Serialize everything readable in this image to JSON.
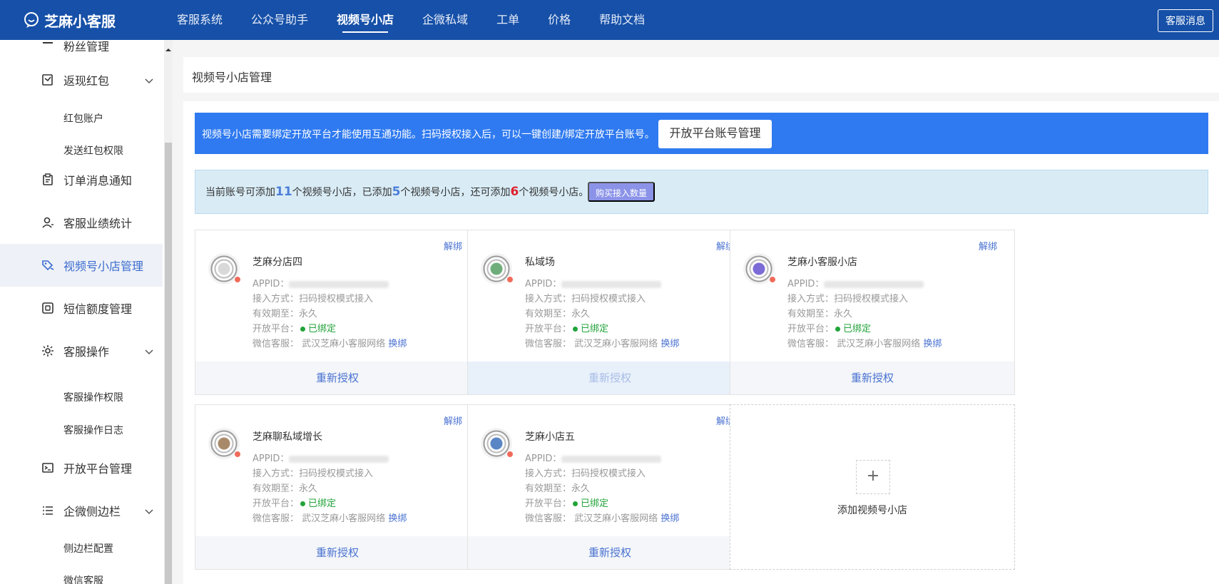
{
  "app": {
    "name": "芝麻小客服"
  },
  "nav": {
    "items": [
      "客服系统",
      "公众号助手",
      "视频号小店",
      "企微私域",
      "工单",
      "价格",
      "帮助文档"
    ],
    "active_index": 2,
    "message_button": "客服消息"
  },
  "sidebar": {
    "partial_top": "粉丝管理",
    "items": {
      "cashback": "返现红包",
      "redpack_account": "红包账户",
      "redpack_permission": "发送红包权限",
      "order_notify": "订单消息通知",
      "performance": "客服业绩统计",
      "video_shop": "视频号小店管理",
      "sms_quota": "短信额度管理",
      "cs_ops": "客服操作",
      "cs_ops_permission": "客服操作权限",
      "cs_ops_log": "客服操作日志",
      "open_platform": "开放平台管理",
      "wecom_sidebar": "企微侧边栏",
      "sidebar_config": "侧边栏配置",
      "wechat_cs": "微信客服"
    },
    "icons": {
      "cashback": "redpack-icon",
      "order_notify": "clipboard-icon",
      "performance": "user-stats-icon",
      "video_shop": "shop-icon",
      "sms_quota": "sms-icon",
      "cs_ops": "settings-icon",
      "open_platform": "terminal-icon",
      "wecom_sidebar": "list-icon"
    }
  },
  "page": {
    "title": "视频号小店管理",
    "notice_blue": "视频号小店需要绑定开放平台才能使用互通功能。扫码授权接入后，可以一键创建/绑定开放平台账号。",
    "open_platform_button": "开放平台账号管理",
    "quota": {
      "prefix": "当前账号可添加",
      "total": "11",
      "mid1": "个视频号小店，已添加",
      "added": "5",
      "mid2": "个视频号小店，还可添加",
      "remaining": "6",
      "suffix": "个视频号小店。",
      "buy_button": "购买接入数量"
    },
    "labels": {
      "appid": "APPID：",
      "access_mode": "接入方式：",
      "valid_until": "有效期至：",
      "open_platform": "开放平台：",
      "wechat_cs": "微信客服：",
      "unbind": "解绑",
      "reauthorize": "重新授权",
      "change_binding": "换绑",
      "add_shop": "添加视频号小店",
      "add_plus": "+"
    },
    "shops": [
      {
        "name": "芝麻分店四",
        "access_mode": "扫码授权模式接入",
        "valid_until": "永久",
        "platform_status": "已绑定",
        "wechat_cs": "武汉芝麻小客服网络",
        "reauth_disabled": false,
        "avatar_color": "#d9d9d9"
      },
      {
        "name": "私域场",
        "access_mode": "扫码授权模式接入",
        "valid_until": "永久",
        "platform_status": "已绑定",
        "wechat_cs": "武汉芝麻小客服网络",
        "reauth_disabled": true,
        "avatar_color": "#6fae7a"
      },
      {
        "name": "芝麻小客服小店",
        "access_mode": "扫码授权模式接入",
        "valid_until": "永久",
        "platform_status": "已绑定",
        "wechat_cs": "武汉芝麻小客服网络",
        "reauth_disabled": false,
        "avatar_color": "#7b6bd6"
      },
      {
        "name": "芝麻聊私域增长",
        "access_mode": "扫码授权模式接入",
        "valid_until": "永久",
        "platform_status": "已绑定",
        "wechat_cs": "武汉芝麻小客服网络",
        "reauth_disabled": false,
        "avatar_color": "#a88a6a"
      },
      {
        "name": "芝麻小店五",
        "access_mode": "扫码授权模式接入",
        "valid_until": "永久",
        "platform_status": "已绑定",
        "wechat_cs": "武汉芝麻小客服网络",
        "reauth_disabled": false,
        "avatar_color": "#5a86c6"
      }
    ]
  },
  "colors": {
    "brand": "#1650a8",
    "notice_blue": "#2f7af0",
    "link": "#4a72d1",
    "bound_green": "#22a33a",
    "quota_red": "#e0202d"
  }
}
